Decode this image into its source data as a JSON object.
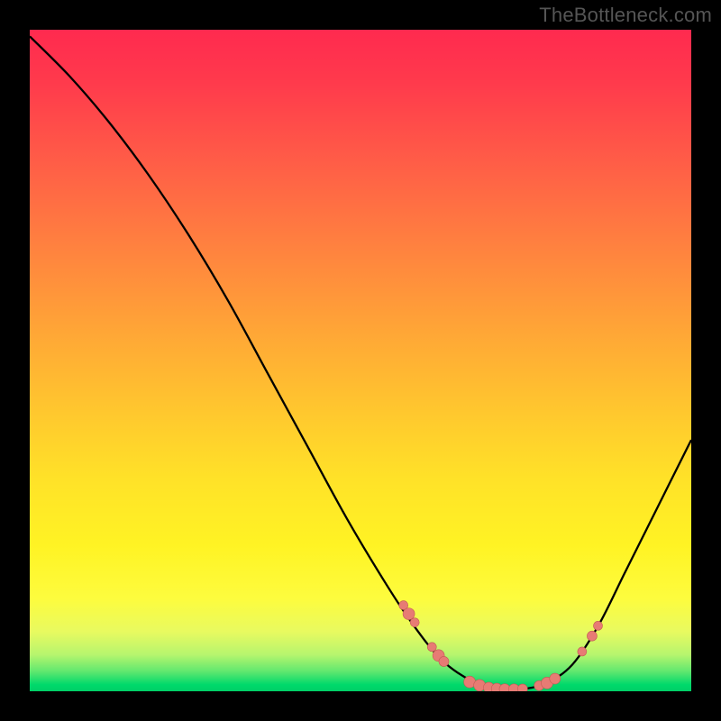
{
  "watermark": "TheBottleneck.com",
  "colors": {
    "marker_fill": "#e77b74",
    "marker_stroke": "#c25a54",
    "curve_stroke": "#000000"
  },
  "chart_data": {
    "type": "line",
    "title": "",
    "xlabel": "",
    "ylabel": "",
    "xlim": [
      0,
      100
    ],
    "ylim": [
      0,
      100
    ],
    "curve": [
      {
        "x": 0,
        "y": 99
      },
      {
        "x": 6,
        "y": 93
      },
      {
        "x": 12,
        "y": 86
      },
      {
        "x": 18,
        "y": 78
      },
      {
        "x": 24,
        "y": 69
      },
      {
        "x": 30,
        "y": 59
      },
      {
        "x": 36,
        "y": 48
      },
      {
        "x": 42,
        "y": 37
      },
      {
        "x": 48,
        "y": 26
      },
      {
        "x": 54,
        "y": 16
      },
      {
        "x": 58,
        "y": 10
      },
      {
        "x": 62,
        "y": 5
      },
      {
        "x": 66,
        "y": 2
      },
      {
        "x": 70,
        "y": 0.5
      },
      {
        "x": 74,
        "y": 0.3
      },
      {
        "x": 78,
        "y": 1.2
      },
      {
        "x": 82,
        "y": 4
      },
      {
        "x": 86,
        "y": 10
      },
      {
        "x": 90,
        "y": 18
      },
      {
        "x": 95,
        "y": 28
      },
      {
        "x": 100,
        "y": 38
      }
    ],
    "markers": [
      {
        "x": 56.5,
        "y": 13,
        "r": 5
      },
      {
        "x": 57.3,
        "y": 11.7,
        "r": 6.5
      },
      {
        "x": 58.2,
        "y": 10.4,
        "r": 5
      },
      {
        "x": 60.8,
        "y": 6.7,
        "r": 5
      },
      {
        "x": 61.8,
        "y": 5.4,
        "r": 6.5
      },
      {
        "x": 62.6,
        "y": 4.5,
        "r": 5.5
      },
      {
        "x": 66.5,
        "y": 1.4,
        "r": 6.5
      },
      {
        "x": 68.0,
        "y": 0.9,
        "r": 6.5
      },
      {
        "x": 69.4,
        "y": 0.55,
        "r": 6
      },
      {
        "x": 70.6,
        "y": 0.4,
        "r": 6
      },
      {
        "x": 71.8,
        "y": 0.32,
        "r": 6
      },
      {
        "x": 73.2,
        "y": 0.3,
        "r": 6
      },
      {
        "x": 74.5,
        "y": 0.35,
        "r": 5.5
      },
      {
        "x": 77.0,
        "y": 0.85,
        "r": 5.5
      },
      {
        "x": 78.2,
        "y": 1.25,
        "r": 6.5
      },
      {
        "x": 79.4,
        "y": 1.9,
        "r": 6
      },
      {
        "x": 83.5,
        "y": 6.0,
        "r": 5
      },
      {
        "x": 85.0,
        "y": 8.35,
        "r": 5.5
      },
      {
        "x": 85.9,
        "y": 9.9,
        "r": 5
      }
    ]
  }
}
